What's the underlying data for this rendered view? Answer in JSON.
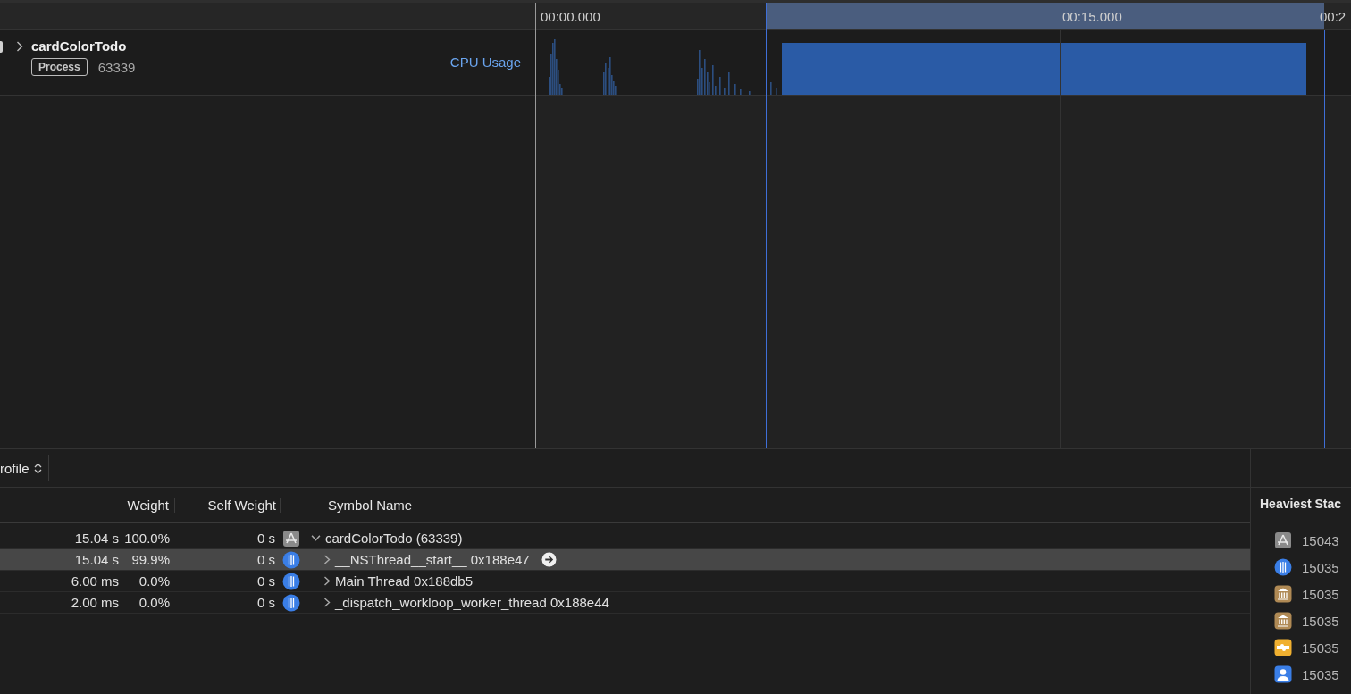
{
  "ruler": {
    "ticks": [
      "00:00.000",
      "00:15.000",
      "00:2"
    ]
  },
  "track": {
    "name": "cardColorTodo",
    "expanded": false,
    "badge": "Process",
    "pid": "63339",
    "instrument": "CPU Usage"
  },
  "detail": {
    "view_menu": "rofile",
    "columns": [
      "Weight",
      "Self Weight",
      "Symbol Name"
    ],
    "rows": [
      {
        "weight": "15.04 s",
        "percent": "100.0%",
        "self_weight": "0 s",
        "kind": "app",
        "symbol": "cardColorTodo (63339)",
        "expanded": true,
        "selected": false,
        "children": [
          {
            "weight": "15.04 s",
            "percent": "99.9%",
            "self_weight": "0 s",
            "kind": "thread",
            "symbol": "__NSThread__start__  0x188e47",
            "expanded": false,
            "selected": true
          },
          {
            "weight": "6.00 ms",
            "percent": "0.0%",
            "self_weight": "0 s",
            "kind": "thread",
            "symbol": "Main Thread  0x188db5",
            "expanded": false,
            "selected": false
          },
          {
            "weight": "2.00 ms",
            "percent": "0.0%",
            "self_weight": "0 s",
            "kind": "thread",
            "symbol": "_dispatch_workloop_worker_thread  0x188e44",
            "expanded": false,
            "selected": false
          }
        ]
      }
    ]
  },
  "heaviest_stack": {
    "title": "Heaviest Stac",
    "items": [
      {
        "kind": "app",
        "count": "15043"
      },
      {
        "kind": "thread",
        "count": "15035"
      },
      {
        "kind": "library",
        "count": "15035"
      },
      {
        "kind": "library",
        "count": "15035"
      },
      {
        "kind": "plugin",
        "count": "15035"
      },
      {
        "kind": "person",
        "count": "15035"
      }
    ]
  }
}
